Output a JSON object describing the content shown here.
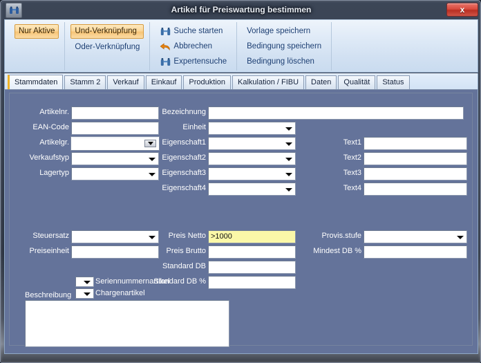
{
  "window": {
    "title": "Artikel für Preiswartung bestimmen",
    "icon": "binoculars-icon",
    "close_label": "x",
    "panel_color": "#64739a",
    "accent_color": "#f0b429",
    "highlight_field_color": "#fbf8a8"
  },
  "ribbon": {
    "groups": [
      {
        "name": "filter-group",
        "buttons": [
          {
            "label": "Nur Aktive",
            "icon": null,
            "toggled": true
          }
        ]
      },
      {
        "name": "link-group",
        "buttons": [
          {
            "label": "Und-Verknüpfung",
            "icon": null,
            "toggled": true
          },
          {
            "label": "Oder-Verknüpfung",
            "icon": null,
            "toggled": false
          }
        ]
      },
      {
        "name": "search-group",
        "buttons": [
          {
            "label": "Suche starten",
            "icon": "binoculars-icon",
            "toggled": false
          },
          {
            "label": "Abbrechen",
            "icon": "undo-arrow-icon",
            "toggled": false
          },
          {
            "label": "Expertensuche",
            "icon": "binoculars-icon",
            "toggled": false
          }
        ]
      },
      {
        "name": "template-group",
        "buttons": [
          {
            "label": "Vorlage speichern",
            "icon": null,
            "toggled": false
          },
          {
            "label": "Bedingung speichern",
            "icon": null,
            "toggled": false
          },
          {
            "label": "Bedingung löschen",
            "icon": null,
            "toggled": false
          }
        ]
      }
    ]
  },
  "tabs": [
    {
      "label": "Stammdaten",
      "active": true
    },
    {
      "label": "Stamm 2",
      "active": false
    },
    {
      "label": "Verkauf",
      "active": false
    },
    {
      "label": "Einkauf",
      "active": false
    },
    {
      "label": "Produktion",
      "active": false
    },
    {
      "label": "Kalkulation / FIBU",
      "active": false
    },
    {
      "label": "Daten",
      "active": false
    },
    {
      "label": "Qualität",
      "active": false
    },
    {
      "label": "Status",
      "active": false
    }
  ],
  "form": {
    "col1": [
      {
        "label": "Artikelnr.",
        "type": "text",
        "value": ""
      },
      {
        "label": "EAN-Code",
        "type": "text",
        "value": ""
      },
      {
        "label": "Artikelgr.",
        "type": "combo-raised",
        "value": ""
      },
      {
        "label": "Verkaufstyp",
        "type": "combo",
        "value": ""
      },
      {
        "label": "Lagertyp",
        "type": "combo",
        "value": ""
      }
    ],
    "flags": [
      {
        "label": "Seriennummernartikel",
        "type": "combo",
        "value": ""
      },
      {
        "label": "Chargenartikel",
        "type": "combo",
        "value": ""
      }
    ],
    "col2": [
      {
        "label": "Bezeichnung",
        "type": "text",
        "value": ""
      },
      {
        "label": "Einheit",
        "type": "combo",
        "value": ""
      },
      {
        "label": "Eigenschaft1",
        "type": "combo",
        "value": ""
      },
      {
        "label": "Eigenschaft2",
        "type": "combo",
        "value": ""
      },
      {
        "label": "Eigenschaft3",
        "type": "combo",
        "value": ""
      },
      {
        "label": "Eigenschaft4",
        "type": "combo",
        "value": ""
      }
    ],
    "col3": [
      {
        "label": "Text1",
        "type": "text",
        "value": ""
      },
      {
        "label": "Text2",
        "type": "text",
        "value": ""
      },
      {
        "label": "Text3",
        "type": "text",
        "value": ""
      },
      {
        "label": "Text4",
        "type": "text",
        "value": ""
      }
    ],
    "lower_left": [
      {
        "label": "Steuersatz",
        "type": "combo",
        "value": ""
      },
      {
        "label": "Preiseinheit",
        "type": "text",
        "value": ""
      }
    ],
    "lower_mid": [
      {
        "label": "Preis Netto",
        "type": "text",
        "value": ">1000",
        "highlighted": true
      },
      {
        "label": "Preis Brutto",
        "type": "text",
        "value": ""
      },
      {
        "label": "Standard DB",
        "type": "text",
        "value": ""
      },
      {
        "label": "Standard DB %",
        "type": "text",
        "value": ""
      }
    ],
    "lower_right": [
      {
        "label": "Provis.stufe",
        "type": "combo",
        "value": ""
      },
      {
        "label": "Mindest DB %",
        "type": "text",
        "value": ""
      }
    ],
    "description": {
      "label": "Beschreibung",
      "value": ""
    }
  }
}
